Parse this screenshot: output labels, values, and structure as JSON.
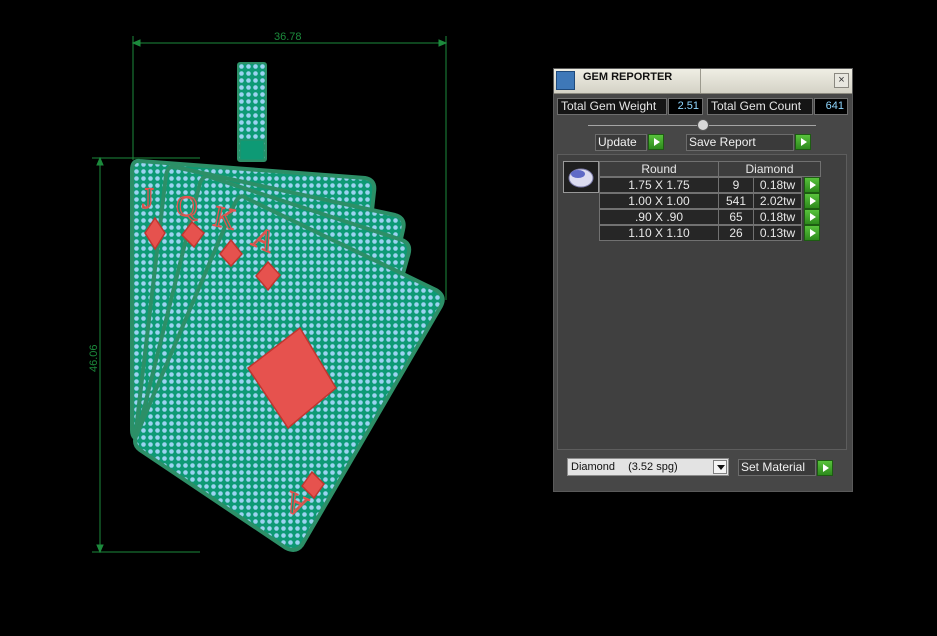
{
  "drawing": {
    "width_dimension": "36.78",
    "height_dimension": "46.06",
    "card_letters": [
      "J",
      "Q",
      "K",
      "A"
    ],
    "colors": {
      "outline": "#2c8f67",
      "card_fill": "#0e9a75",
      "pave": "#9bd3f1",
      "suit": "#e6524e",
      "dimension": "#1c8a3c"
    }
  },
  "gem_reporter": {
    "title": "GEM REPORTER",
    "icons": {
      "app": "gem-reporter-app-icon",
      "close": "close-icon",
      "gem": "round-diamond-gem-icon"
    },
    "close_glyph": "×",
    "total_gem_weight_label": "Total Gem Weight",
    "total_gem_weight": "2.51",
    "total_gem_count_label": "Total Gem Count",
    "total_gem_count": "641",
    "update_label": "Update",
    "save_report_label": "Save Report",
    "table": {
      "headers": [
        "Round",
        "Diamond"
      ],
      "rows": [
        {
          "size": "1.75 X 1.75",
          "count": "9",
          "weight": "0.18tw"
        },
        {
          "size": "1.00 X 1.00",
          "count": "541",
          "weight": "2.02tw"
        },
        {
          "size": ".90 X .90",
          "count": "65",
          "weight": "0.18tw"
        },
        {
          "size": "1.10 X 1.10",
          "count": "26",
          "weight": "0.13tw"
        }
      ]
    },
    "material_name": "Diamond",
    "material_spg": "(3.52 spg)",
    "set_material_label": "Set Material"
  }
}
